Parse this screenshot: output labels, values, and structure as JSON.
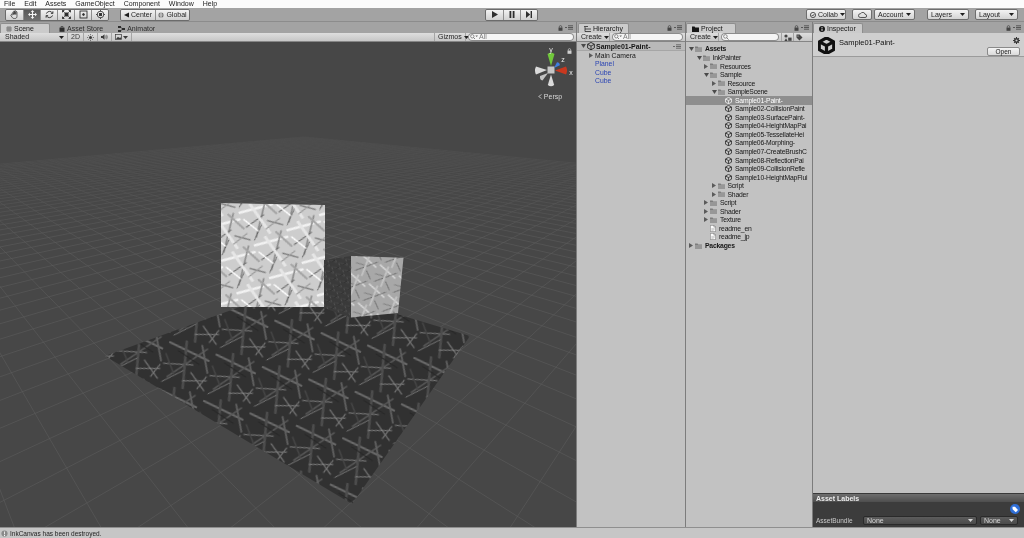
{
  "menu_bar": [
    {
      "label": "File"
    },
    {
      "label": "Edit"
    },
    {
      "label": "Assets"
    },
    {
      "label": "GameObject"
    },
    {
      "label": "Component"
    },
    {
      "label": "Window"
    },
    {
      "label": "Help"
    }
  ],
  "toolbar": {
    "tools": [
      {
        "kind": "hand",
        "selected": false
      },
      {
        "kind": "move",
        "selected": true
      },
      {
        "kind": "rotate",
        "selected": false
      },
      {
        "kind": "scale",
        "selected": false
      },
      {
        "kind": "rect",
        "selected": false
      },
      {
        "kind": "transform",
        "selected": false
      }
    ],
    "pivot_mode": "Center",
    "pivot_rotation": "Global",
    "playback": [
      {
        "kind": "play"
      },
      {
        "kind": "pause"
      },
      {
        "kind": "step"
      }
    ],
    "collab": "Collab",
    "account": "Account",
    "layers": "Layers",
    "layout": "Layout"
  },
  "scene_panel": {
    "tabs": [
      {
        "kind": "scene",
        "label": "Scene",
        "selected": true
      },
      {
        "kind": "store",
        "label": "Asset Store",
        "selected": false
      },
      {
        "kind": "animator",
        "label": "Animator",
        "selected": false
      }
    ],
    "shading": "Shaded",
    "view_2d": {
      "label": "2D",
      "on": false
    },
    "toggles": [
      {
        "kind": "lighting",
        "on": false
      },
      {
        "kind": "audio",
        "on": false
      }
    ],
    "gizmos": "Gizmos",
    "search": {
      "placeholder": "All"
    },
    "gizmo_axes": [
      {
        "label": "y",
        "color": "#72c83c"
      },
      {
        "label": "z",
        "color": "#3f7fe0"
      },
      {
        "label": "x",
        "color": "#c8381f"
      }
    ],
    "projection": "Persp"
  },
  "hierarchy": {
    "tabs": [
      {
        "kind": "hierarchy",
        "label": "Hierarchy",
        "selected": true
      }
    ],
    "create": "Create",
    "search": {
      "placeholder": "All"
    },
    "scene": {
      "name": "Sample01-Paint-",
      "expanded": true,
      "children": [
        {
          "name": "Main Camera",
          "prefab": false,
          "collapsed": true
        },
        {
          "name": "Planel",
          "prefab": true,
          "collapsed": false
        },
        {
          "name": "Cube",
          "prefab": true,
          "collapsed": false
        },
        {
          "name": "Cube",
          "prefab": true,
          "collapsed": false
        }
      ]
    }
  },
  "project": {
    "tabs": [
      {
        "kind": "project",
        "label": "Project",
        "selected": true
      }
    ],
    "create": "Create",
    "tree": [
      {
        "name": "Assets",
        "kind": "folder",
        "expanded": true,
        "selected": false,
        "children": [
          {
            "name": "InkPainter",
            "kind": "folder",
            "expanded": true,
            "selected": false,
            "children": [
              {
                "name": "Resources",
                "kind": "folder",
                "expanded": false,
                "selected": false
              },
              {
                "name": "Sample",
                "kind": "folder",
                "expanded": true,
                "selected": false,
                "children": [
                  {
                    "name": "Resource",
                    "kind": "folder",
                    "expanded": false,
                    "selected": false
                  },
                  {
                    "name": "SampleScene",
                    "kind": "folder",
                    "expanded": true,
                    "selected": false,
                    "children": [
                      {
                        "name": "Sample01-Paint-",
                        "kind": "scene",
                        "selected": true
                      },
                      {
                        "name": "Sample02-CollisionPaint",
                        "kind": "scene",
                        "selected": false
                      },
                      {
                        "name": "Sample03-SurfacePaint-",
                        "kind": "scene",
                        "selected": false
                      },
                      {
                        "name": "Sample04-HeightMapPai",
                        "kind": "scene",
                        "selected": false
                      },
                      {
                        "name": "Sample05-TessellateHei",
                        "kind": "scene",
                        "selected": false
                      },
                      {
                        "name": "Sample06-Morphing-",
                        "kind": "scene",
                        "selected": false
                      },
                      {
                        "name": "Sample07-CreateBrushC",
                        "kind": "scene",
                        "selected": false
                      },
                      {
                        "name": "Sample08-ReflectionPai",
                        "kind": "scene",
                        "selected": false
                      },
                      {
                        "name": "Sample09-CollisionRefle",
                        "kind": "scene",
                        "selected": false
                      },
                      {
                        "name": "Sample10-HeightMapFlui",
                        "kind": "scene",
                        "selected": false
                      }
                    ]
                  },
                  {
                    "name": "Script",
                    "kind": "folder",
                    "expanded": false,
                    "selected": false
                  },
                  {
                    "name": "Shader",
                    "kind": "folder",
                    "expanded": false,
                    "selected": false
                  }
                ]
              },
              {
                "name": "Script",
                "kind": "folder",
                "expanded": false,
                "selected": false
              },
              {
                "name": "Shader",
                "kind": "folder",
                "expanded": false,
                "selected": false
              },
              {
                "name": "Texture",
                "kind": "folder",
                "expanded": false,
                "selected": false
              },
              {
                "name": "readme_en",
                "kind": "text",
                "selected": false
              },
              {
                "name": "readme_jp",
                "kind": "text",
                "selected": false
              }
            ]
          }
        ]
      },
      {
        "name": "Packages",
        "kind": "folder",
        "expanded": false,
        "selected": false
      }
    ]
  },
  "inspector": {
    "tabs": [
      {
        "kind": "inspector",
        "label": "Inspector",
        "selected": true
      }
    ],
    "asset_name": "Sample01-Paint-",
    "open_button": "Open",
    "asset_labels": {
      "title": "Asset Labels",
      "bundle_label": "AssetBundle",
      "bundle": "None",
      "variant": "None"
    }
  },
  "status_bar": {
    "message": "InkCanvas has been destroyed."
  }
}
